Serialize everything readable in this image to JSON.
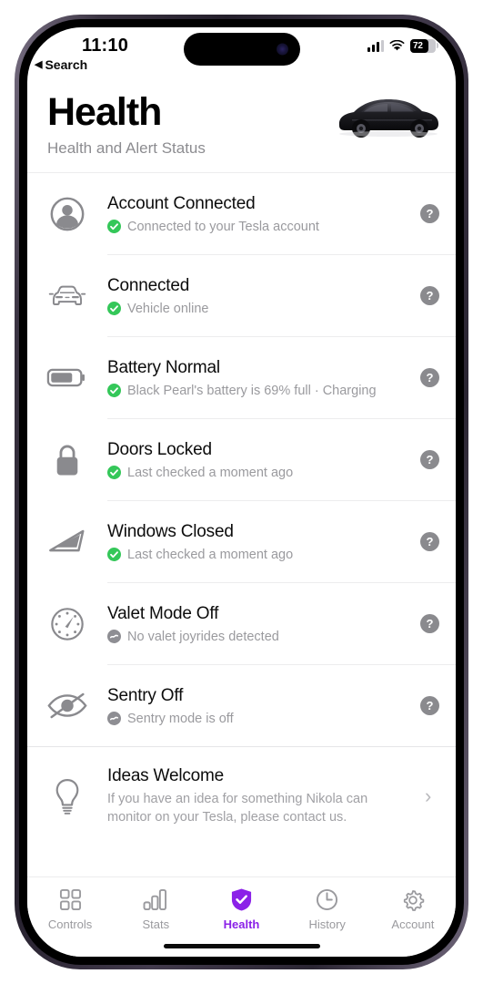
{
  "statusbar": {
    "time": "11:10",
    "back_label": "Search",
    "back_arrow": "◀",
    "battery_level": "72",
    "signal_icon": "cellular-bars-icon",
    "wifi_icon": "wifi-icon",
    "battery_icon": "battery-icon"
  },
  "header": {
    "title": "Health",
    "subtitle": "Health and Alert Status",
    "vehicle_image": "tesla-model-3-black"
  },
  "colors": {
    "accent": "#8B21E8",
    "status_ok": "#34C759",
    "status_off": "#8E8E93",
    "help_button": "#8A8A8E",
    "secondary_text": "#9A9A9E"
  },
  "list": {
    "help_label": "?",
    "items": [
      {
        "icon": "account-circle-icon",
        "title": "Account Connected",
        "status": "Connected to your Tesla account",
        "status_type": "ok",
        "help": "?"
      },
      {
        "icon": "car-front-icon",
        "title": "Connected",
        "status": "Vehicle online",
        "status_type": "ok",
        "help": "?"
      },
      {
        "icon": "battery-icon",
        "title": "Battery Normal",
        "status": "Black Pearl's battery is 69% full · Charging",
        "status_type": "ok",
        "help": "?"
      },
      {
        "icon": "lock-icon",
        "title": "Doors Locked",
        "status": "Last checked a moment ago",
        "status_type": "ok",
        "help": "?"
      },
      {
        "icon": "window-icon",
        "title": "Windows Closed",
        "status": "Last checked a moment ago",
        "status_type": "ok",
        "help": "?"
      },
      {
        "icon": "speedometer-icon",
        "title": "Valet Mode Off",
        "status": "No valet joyrides detected",
        "status_type": "off",
        "help": "?"
      },
      {
        "icon": "eye-slash-icon",
        "title": "Sentry Off",
        "status": "Sentry mode is off",
        "status_type": "off",
        "help": "?"
      }
    ],
    "idea_row": {
      "icon": "lightbulb-icon",
      "title": "Ideas Welcome",
      "description": "If you have an idea for something Nikola can monitor on your Tesla, please contact us.",
      "chevron": "›"
    }
  },
  "tabbar": {
    "tabs": [
      {
        "label": "Controls",
        "icon": "grid-icon",
        "active": false
      },
      {
        "label": "Stats",
        "icon": "bar-chart-icon",
        "active": false
      },
      {
        "label": "Health",
        "icon": "shield-check-icon",
        "active": true
      },
      {
        "label": "History",
        "icon": "clock-icon",
        "active": false
      },
      {
        "label": "Account",
        "icon": "gear-icon",
        "active": false
      }
    ]
  }
}
